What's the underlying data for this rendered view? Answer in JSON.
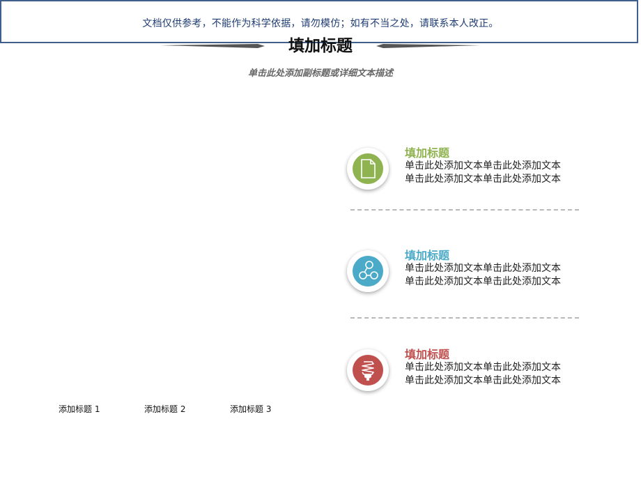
{
  "banner": {
    "text": "文档仅供参考，不能作为科学依据，请勿模仿；如有不当之处，请联系本人改正。"
  },
  "header": {
    "title": "填加标题",
    "subtitle": "单击此处添加副标题或详细文本描述"
  },
  "items": [
    {
      "title": "填加标题",
      "line1": "单击此处添加文本单击此处添加文本",
      "line2": "单击此处添加文本单击此处添加文本",
      "color": "#8fb350",
      "icon": "document-icon"
    },
    {
      "title": "填加标题",
      "line1": "单击此处添加文本单击此处添加文本",
      "line2": "单击此处添加文本单击此处添加文本",
      "color": "#4aaac8",
      "icon": "network-icon"
    },
    {
      "title": "填加标题",
      "line1": "单击此处添加文本单击此处添加文本",
      "line2": "单击此处添加文本单击此处添加文本",
      "color": "#c0504d",
      "icon": "lightbulb-icon"
    }
  ],
  "bottom_labels": [
    "添加标题 1",
    "添加标题 2",
    "添加标题 3"
  ]
}
